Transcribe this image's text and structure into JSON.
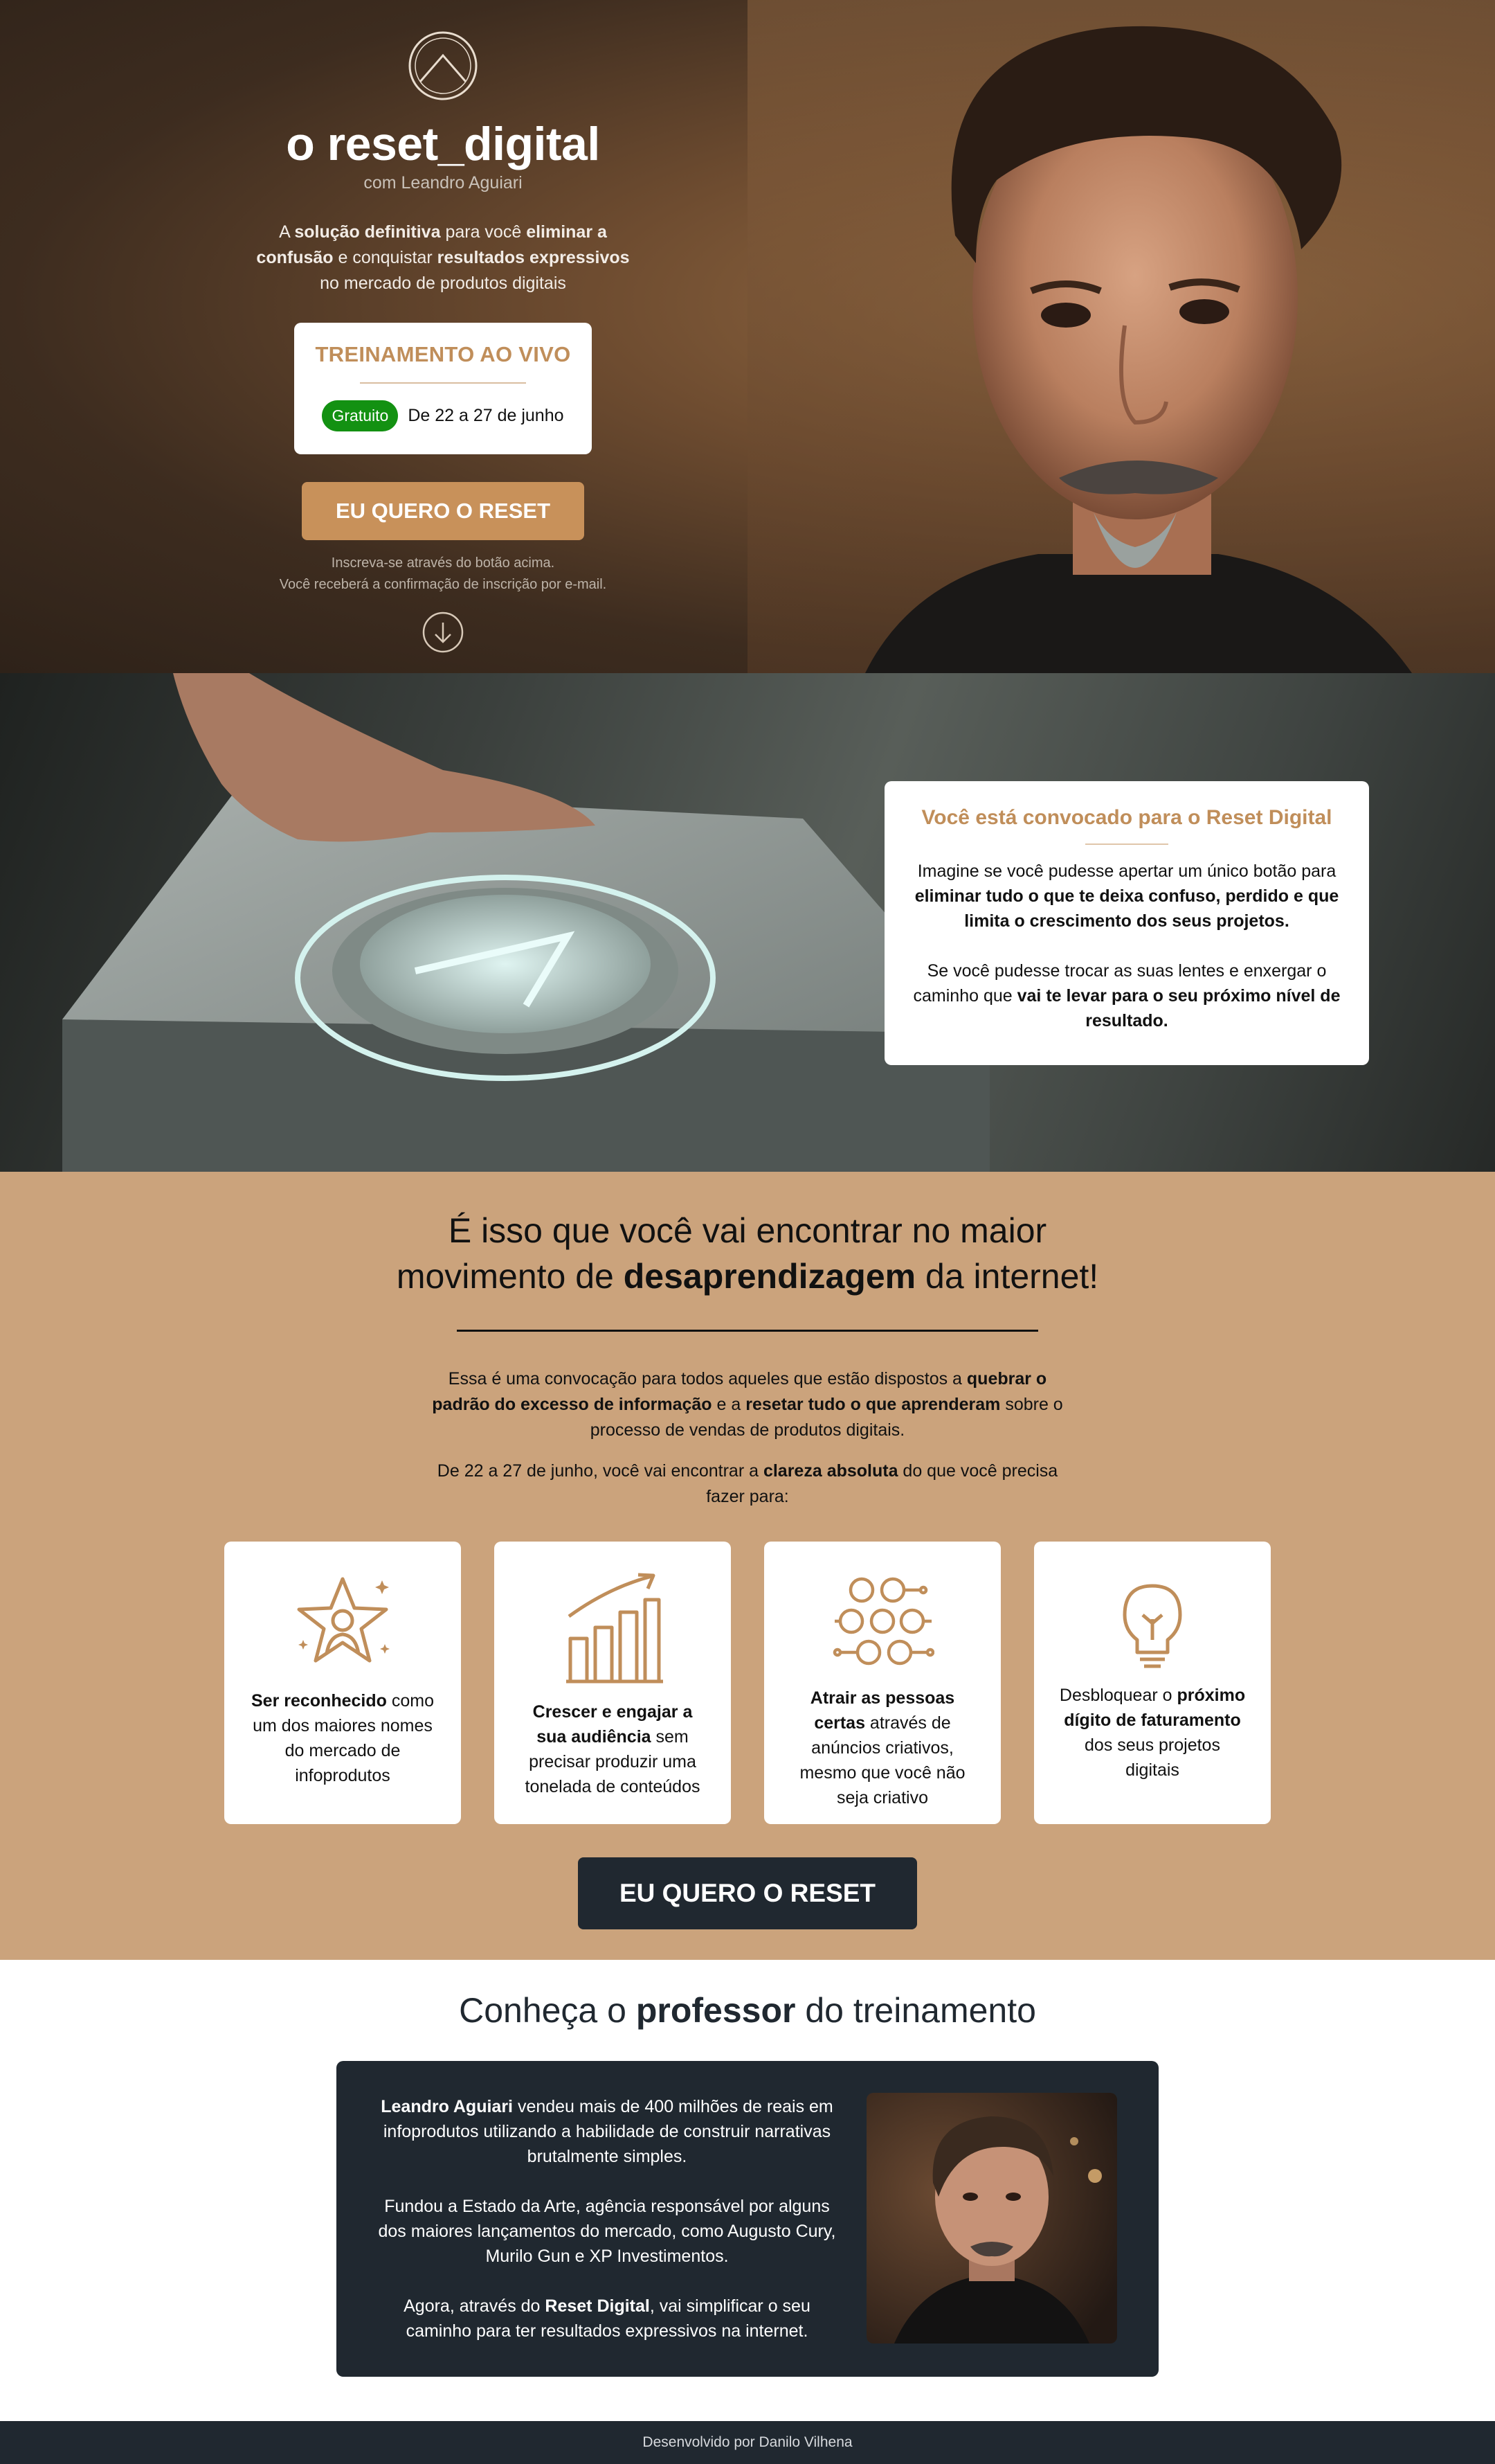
{
  "hero": {
    "brand_title": "o reset_digital",
    "brand_sub": "com Leandro Aguiari",
    "desc": {
      "p1": "A ",
      "b1": "solução definitiva",
      "p2": " para você ",
      "b2": "eliminar a confusão",
      "p3": " e conquistar ",
      "b3": "resultados expressivos",
      "p4": " no mercado de produtos digitais"
    },
    "live_title": "TREINAMENTO AO VIVO",
    "badge": "Gratuito",
    "dates": "De 22 a 27 de junho",
    "cta": "EU QUERO O RESET",
    "note_line1": "Inscreva-se através do botão acima.",
    "note_line2": "Você receberá a confirmação de inscrição por e-mail."
  },
  "convocado": {
    "title": "Você está convocado para o Reset Digital",
    "p1a": "Imagine se você pudesse apertar um único botão para ",
    "p1b": "eliminar tudo o que te deixa confuso, perdido e que limita o crescimento dos seus projetos.",
    "p2a": "Se você pudesse trocar as suas lentes e enxergar o caminho que ",
    "p2b": "vai te levar para o seu próximo nível de resultado."
  },
  "desap": {
    "h_line1": "É isso que você vai encontrar no maior",
    "h_line2a": "movimento de ",
    "h_line2b": "desaprendizagem",
    "h_line2c": " da internet!",
    "p1a": "Essa é uma convocação para todos aqueles que estão dispostos a ",
    "p1b": "quebrar o padrão do excesso de informação",
    "p1c": " e a ",
    "p1d": "resetar tudo o que aprenderam",
    "p1e": " sobre o processo de vendas de produtos digitais.",
    "p2a": "De 22 a 27 de junho, você vai encontrar a ",
    "p2b": "clareza absoluta",
    "p2c": " do que você precisa fazer para:",
    "cards": [
      {
        "icon": "star-person-icon",
        "bold": "Ser reconhecido",
        "rest": " como um dos maiores nomes do mercado de infoprodutos"
      },
      {
        "icon": "growth-chart-icon",
        "bold": "Crescer e engajar a sua audiência",
        "rest": " sem precisar produzir uma tonelada de conteúdos"
      },
      {
        "icon": "network-people-icon",
        "bold": "Atrair as pessoas certas",
        "rest": " através de anúncios criativos, mesmo que você não seja criativo"
      },
      {
        "icon": "lightbulb-icon",
        "pre": "Desbloquear o ",
        "bold": "próximo dígito de faturamento",
        "rest": " dos seus projetos digitais"
      }
    ],
    "cta": "EU QUERO O RESET"
  },
  "professor": {
    "h_a": "Conheça o ",
    "h_b": "professor",
    "h_c": " do treinamento",
    "p1b": "Leandro Aguiari",
    "p1": " vendeu mais de 400 milhões de reais em infoprodutos utilizando a habilidade de construir narrativas brutalmente simples.",
    "p2": "Fundou a Estado da Arte, agência responsável por alguns dos maiores lançamentos do mercado, como Augusto Cury, Murilo Gun e XP Investimentos.",
    "p3a": "Agora, através do ",
    "p3b": "Reset Digital",
    "p3c": ", vai simplificar o seu caminho para ter resultados expressivos na internet."
  },
  "footer": {
    "text": "Desenvolvido por Danilo Vilhena"
  },
  "colors": {
    "gold": "#c8915a",
    "tan_bg": "#cba37c",
    "dark": "#202830",
    "badge_green": "#139112"
  }
}
